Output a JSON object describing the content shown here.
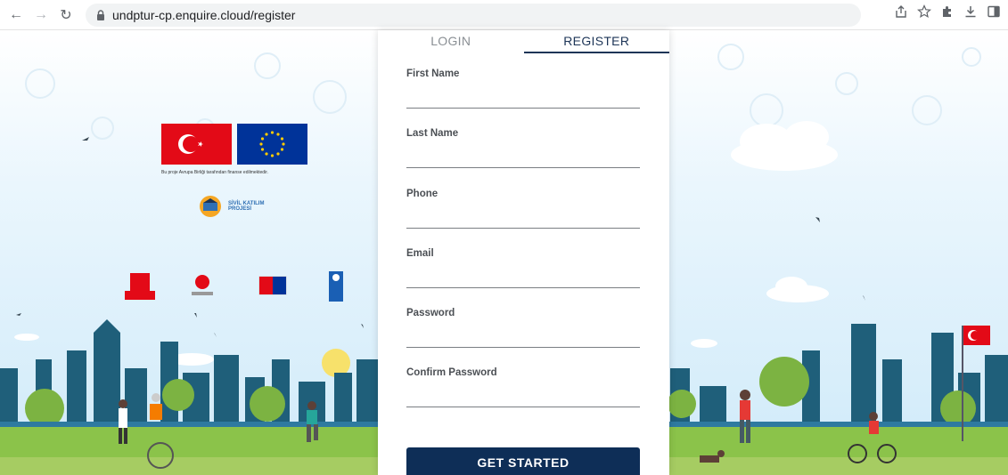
{
  "browser": {
    "back_icon": "arrow-left-icon",
    "forward_icon": "arrow-right-icon",
    "reload_icon": "reload-icon",
    "lock_icon": "lock-icon",
    "url": "undptur-cp.enquire.cloud/register",
    "share_icon": "share-icon",
    "bookmark_icon": "star-icon",
    "extensions_icon": "puzzle-icon",
    "download_icon": "download-icon",
    "sidepanel_icon": "sidepanel-icon"
  },
  "left_branding": {
    "funding_caption": "Bu proje Avrupa Birliği tarafından finanse edilmektedir.",
    "project_name_line1": "SİVİL KATILIM",
    "project_name_line2": "PROJESİ"
  },
  "auth": {
    "tabs": [
      {
        "label": "LOGIN",
        "active": false
      },
      {
        "label": "REGISTER",
        "active": true
      }
    ],
    "fields": [
      {
        "label": "First Name",
        "value": ""
      },
      {
        "label": "Last Name",
        "value": ""
      },
      {
        "label": "Phone",
        "value": ""
      },
      {
        "label": "Email",
        "value": ""
      },
      {
        "label": "Password",
        "value": ""
      },
      {
        "label": "Confirm Password",
        "value": ""
      }
    ],
    "submit_label": "GET STARTED"
  },
  "colors": {
    "primary": "#0e2e57",
    "turkey_red": "#e30a17",
    "eu_blue": "#003399",
    "eu_gold": "#ffcc00",
    "grass": "#8bc34a"
  }
}
